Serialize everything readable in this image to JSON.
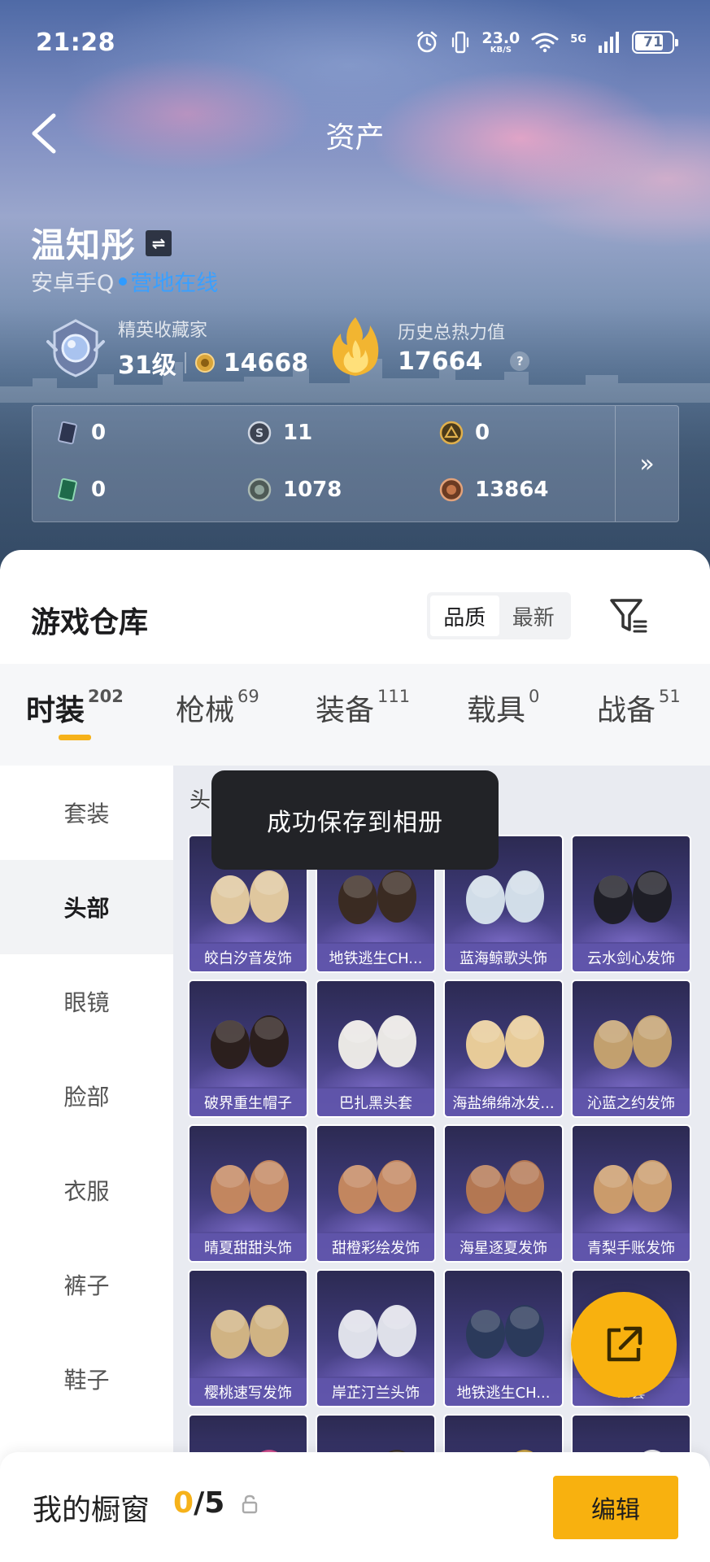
{
  "status_bar": {
    "time": "21:28",
    "net_speed": "23.0",
    "net_unit": "KB/S",
    "network": "5G",
    "battery": "71"
  },
  "nav": {
    "title": "资产"
  },
  "profile": {
    "name": "温知彤",
    "platform": "安卓手Q",
    "online_status": "营地在线",
    "collector_title": "精英收藏家",
    "collector_level": "31级",
    "collector_points": "14668",
    "heat_label": "历史总热力值",
    "heat_value": "17664"
  },
  "currencies": [
    {
      "icon": "dark-card-icon",
      "value": "0"
    },
    {
      "icon": "silver-coin-icon",
      "value": "11"
    },
    {
      "icon": "gold-badge-icon",
      "value": "0"
    },
    {
      "icon": "green-card-icon",
      "value": "0"
    },
    {
      "icon": "gray-coin-icon",
      "value": "1078"
    },
    {
      "icon": "bronze-coin-icon",
      "value": "13864"
    }
  ],
  "warehouse": {
    "title": "游戏仓库",
    "sort_options": [
      "品质",
      "最新"
    ],
    "active_sort": "品质",
    "tabs": [
      {
        "label": "时装",
        "count": "202",
        "active": true
      },
      {
        "label": "枪械",
        "count": "69"
      },
      {
        "label": "装备",
        "count": "111"
      },
      {
        "label": "载具",
        "count": "0"
      },
      {
        "label": "战备",
        "count": "51"
      }
    ],
    "categories": [
      "套装",
      "头部",
      "眼镜",
      "脸部",
      "衣服",
      "裤子",
      "鞋子"
    ],
    "active_category": "头部",
    "section_label": "头",
    "items": [
      "皎白汐音发饰",
      "地铁逃生CH...",
      "蓝海鲸歌头饰",
      "云水剑心发饰",
      "破界重生帽子",
      "巴扎黑头套",
      "海盐绵绵冰发...",
      "沁蓝之约发饰",
      "晴夏甜甜头饰",
      "甜橙彩绘发饰",
      "海星逐夏发饰",
      "青梨手账发饰",
      "樱桃速写发饰",
      "岸芷汀兰头饰",
      "地铁逃生CH...",
      "...套",
      "",
      "",
      "",
      ""
    ]
  },
  "toast": {
    "message": "成功保存到相册"
  },
  "showcase": {
    "label": "我的橱窗",
    "current": "0",
    "total": "/5",
    "edit_label": "编辑"
  },
  "colors": {
    "accent": "#f8b10f",
    "online": "#3aa0ff",
    "card_bg": "#3e3a78"
  }
}
